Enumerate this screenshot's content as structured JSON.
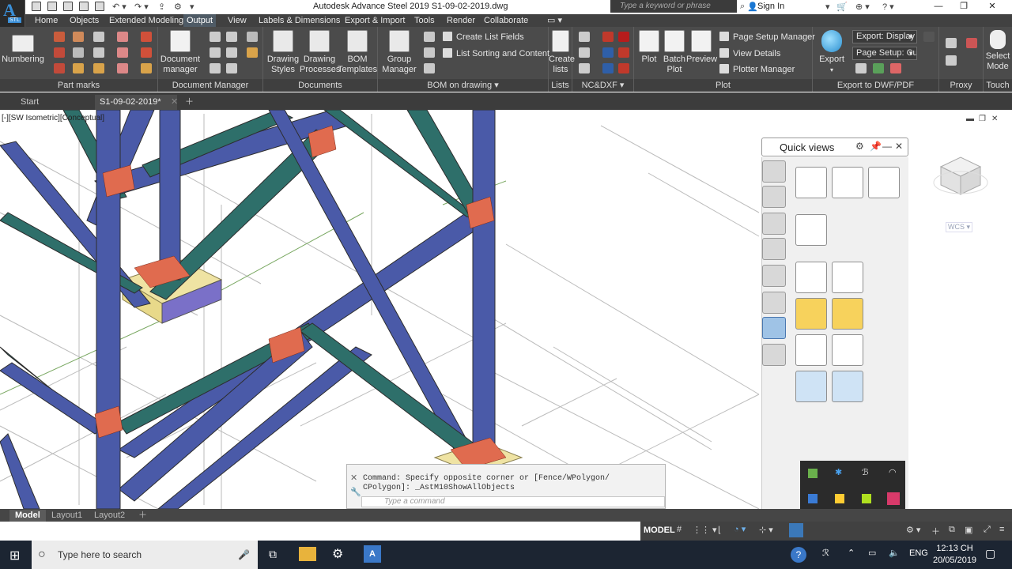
{
  "app": {
    "logo_letter": "A",
    "logo_sub": "STL",
    "title": "Autodesk Advance Steel 2019    S1-09-02-2019.dwg",
    "search_placeholder": "Type a keyword or phrase",
    "sign_in": "Sign In"
  },
  "menu_tabs": [
    "Home",
    "Objects",
    "Extended Modeling",
    "Output",
    "View",
    "Labels & Dimensions",
    "Export & Import",
    "Tools",
    "Render",
    "Collaborate"
  ],
  "active_tab": "Output",
  "ribbon": {
    "part_marks": {
      "label": "Part marks",
      "numbering": "Numbering"
    },
    "document_manager": {
      "label": "Document Manager",
      "button": "Document\nmanager"
    },
    "documents": {
      "label": "Documents",
      "drawing_styles": "Drawing\nStyles",
      "drawing_processes": "Drawing\nProcesses",
      "bom_templates": "BOM\nTemplates"
    },
    "bom_on_drawing": {
      "label": "BOM on drawing",
      "group_manager": "Group\nManager",
      "create_list_fields": "Create List Fields",
      "list_sorting": "List Sorting and Content"
    },
    "lists": {
      "label": "Lists",
      "create_lists": "Create\nlists"
    },
    "ncdxf": {
      "label": "NC&DXF"
    },
    "plot": {
      "label": "Plot",
      "plot": "Plot",
      "batch_plot": "Batch\nPlot",
      "preview": "Preview",
      "page_setup_manager": "Page Setup Manager",
      "view_details": "View Details",
      "plotter_manager": "Plotter Manager"
    },
    "export_dwf": {
      "label": "Export to DWF/PDF",
      "export": "Export",
      "export_display": "Export: Display",
      "page_setup": "Page Setup: Cu"
    },
    "proxy": {
      "label": "Proxy"
    },
    "touch": {
      "label": "Touch",
      "select_mode": "Select\nMode"
    }
  },
  "doc_tabs": [
    "Start",
    "S1-09-02-2019*"
  ],
  "viewport": {
    "label": "[-][SW Isometric][Conceptual]",
    "quick_views_title": "Quick views",
    "viewcube_label": "WCS"
  },
  "command": {
    "history": "Command: Specify opposite corner or [Fence/WPolygon/\nCPolygon]: _AstM10ShowAllObjects",
    "placeholder": "Type a command"
  },
  "layout_tabs": [
    "Model",
    "Layout1",
    "Layout2"
  ],
  "status": {
    "model": "MODEL"
  },
  "taskbar": {
    "search_placeholder": "Type here to search",
    "lang": "ENG",
    "time": "12:13 CH",
    "date": "20/05/2019"
  },
  "colors": {
    "column": "#4a5aa8",
    "brace": "#2e6f6a",
    "plate": "#e06b4f",
    "footing": "#efe3a3"
  }
}
